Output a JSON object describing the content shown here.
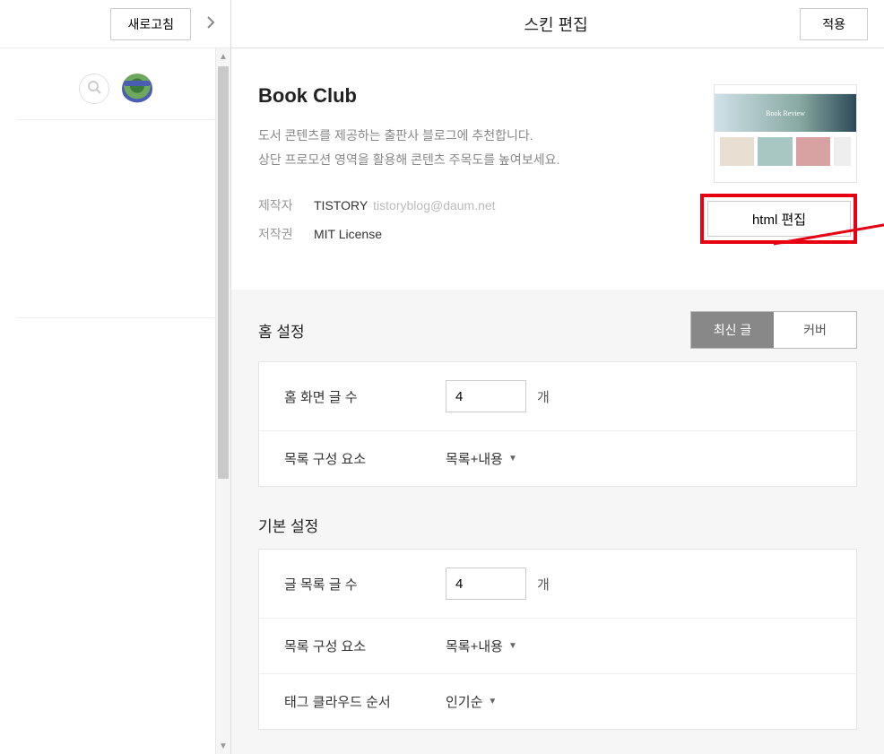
{
  "left": {
    "refresh": "새로고침"
  },
  "header": {
    "title": "스킨 편집",
    "apply": "적용"
  },
  "skin": {
    "name": "Book Club",
    "desc1": "도서 콘텐츠를 제공하는 출판사 블로그에 추천합니다.",
    "desc2": "상단 프로모션 영역을 활용해 콘텐츠 주목도를 높여보세요.",
    "authorLabel": "제작자",
    "authorName": "TISTORY",
    "authorEmail": "tistoryblog@daum.net",
    "licenseLabel": "저작권",
    "licenseValue": "MIT License",
    "htmlEditLabel": "html 편집",
    "thumbHero": "Book Review"
  },
  "home": {
    "title": "홈 설정",
    "tabRecent": "최신 글",
    "tabCover": "커버",
    "rows": {
      "countLabel": "홈 화면 글 수",
      "countValue": "4",
      "countUnit": "개",
      "listLabel": "목록 구성 요소",
      "listValue": "목록+내용"
    }
  },
  "basic": {
    "title": "기본 설정",
    "rows": {
      "countLabel": "글 목록 글 수",
      "countValue": "4",
      "countUnit": "개",
      "listLabel": "목록 구성 요소",
      "listValue": "목록+내용",
      "tagLabel": "태그 클라우드 순서",
      "tagValue": "인기순"
    }
  }
}
